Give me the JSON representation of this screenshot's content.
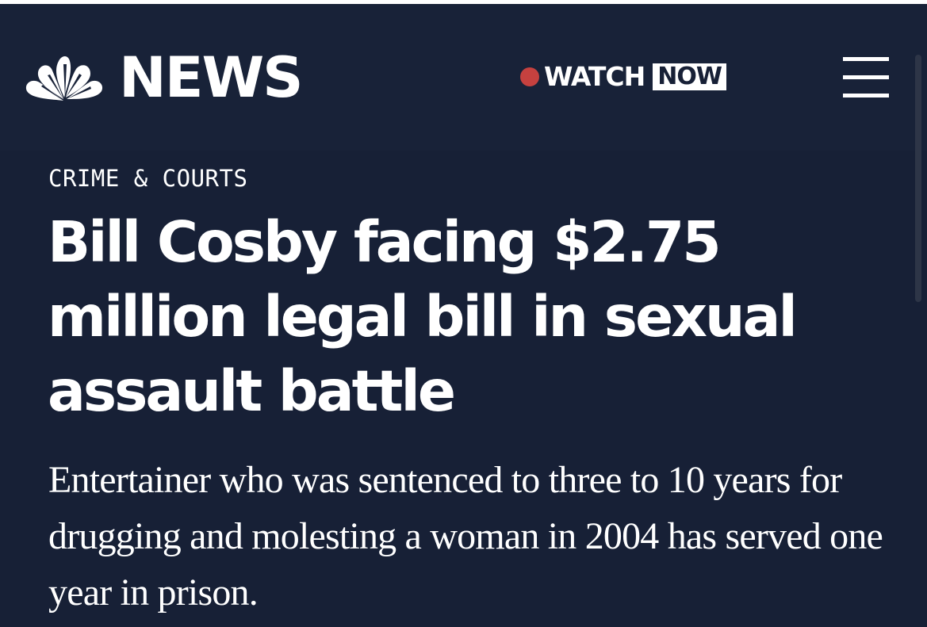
{
  "header": {
    "logo_text": "NEWS",
    "logo_icon": "nbc-peacock-icon",
    "watch_label": "WATCH",
    "now_label": "NOW",
    "live_dot_color": "#c6413f",
    "menu_icon": "hamburger-menu-icon"
  },
  "article": {
    "category": "CRIME & COURTS",
    "headline": "Bill Cosby facing $2.75 million legal bill in sexual assault battle",
    "dek": "Entertainer who was sentenced to three to 10 years for drugging and molesting a woman in 2004 has served one year in prison."
  },
  "colors": {
    "background": "#172036",
    "text": "#ffffff"
  }
}
